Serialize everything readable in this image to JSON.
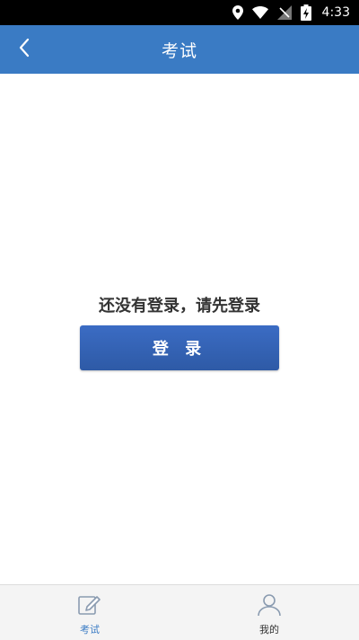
{
  "status_bar": {
    "time": "4:33",
    "icons": [
      "location-icon",
      "wifi-icon",
      "no-signal-icon",
      "battery-charging-icon"
    ]
  },
  "app_bar": {
    "title": "考试",
    "back_icon": "chevron-left-icon"
  },
  "main": {
    "prompt_text": "还没有登录，请先登录",
    "login_button_label": "登 录"
  },
  "bottom_nav": {
    "items": [
      {
        "label": "考试",
        "icon": "edit-icon",
        "active": true
      },
      {
        "label": "我的",
        "icon": "user-icon",
        "active": false
      }
    ]
  },
  "colors": {
    "app_bar": "#3a7bc4",
    "button": "#3366bb",
    "active_tab": "#3a7bc4"
  }
}
